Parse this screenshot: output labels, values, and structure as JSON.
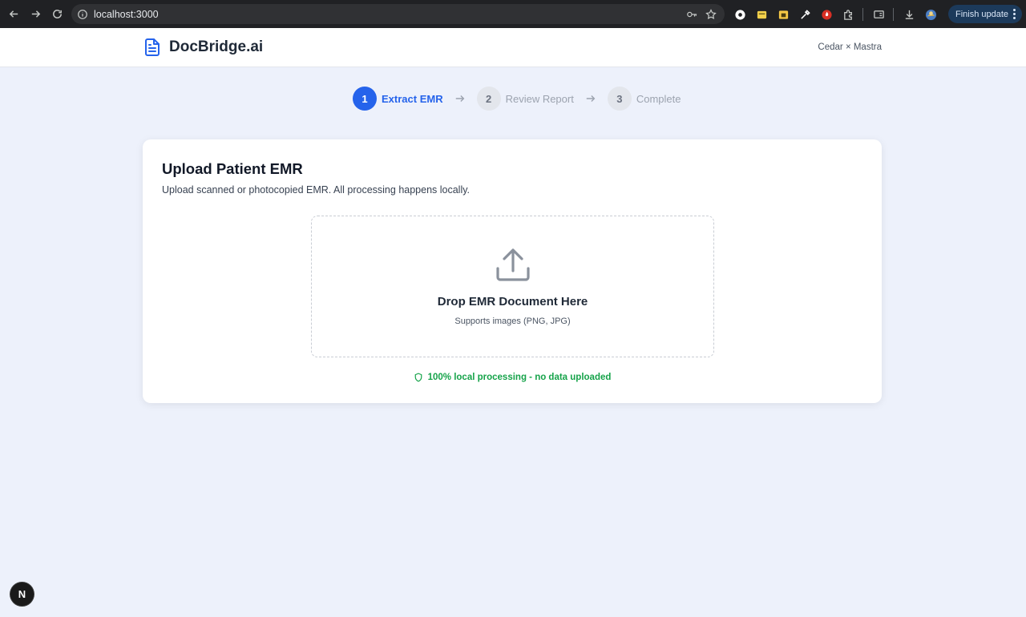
{
  "browser": {
    "url": "localhost:3000",
    "update_label": "Finish update",
    "icons": [
      "back-icon",
      "forward-icon",
      "reload-icon",
      "info-icon",
      "key-icon",
      "star-icon",
      "extensions-icon",
      "download-icon",
      "profile-icon"
    ]
  },
  "header": {
    "brand": "DocBridge.ai",
    "partner": "Cedar × Mastra",
    "brand_color": "#2563eb"
  },
  "steps": [
    {
      "number": "1",
      "label": "Extract EMR",
      "state": "active"
    },
    {
      "number": "2",
      "label": "Review Report",
      "state": "pending"
    },
    {
      "number": "3",
      "label": "Complete",
      "state": "pending"
    }
  ],
  "upload": {
    "title": "Upload Patient EMR",
    "subtitle": "Upload scanned or photocopied EMR. All processing happens locally.",
    "drop_title": "Drop EMR Document Here",
    "drop_hint": "Supports images (PNG, JPG)",
    "privacy_note": "100% local processing - no data uploaded",
    "privacy_color": "#16a34a"
  },
  "dev_badge": "N"
}
